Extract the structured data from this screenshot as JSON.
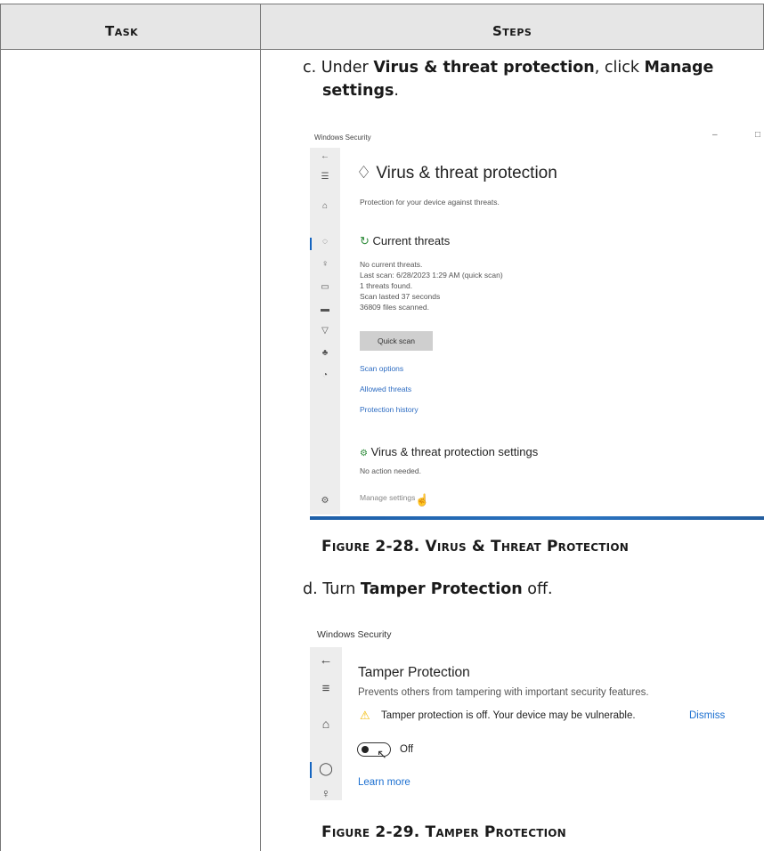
{
  "table": {
    "col_task": "Task",
    "col_steps": "Steps"
  },
  "step_c": {
    "marker": "c.",
    "pre": "Under ",
    "bold1": "Virus & threat protection",
    "mid": ", click ",
    "bold2": "Manage",
    "bold2b": "settings",
    "end": "."
  },
  "figure1": {
    "caption": "Figure 2-28. Virus & Threat Protection",
    "window_title": "Windows Security",
    "page_title": "Virus & threat protection",
    "page_subtitle": "Protection for your device against threats.",
    "section_current": "Current threats",
    "current_lines": [
      "No current threats.",
      "Last scan: 6/28/2023 1:29 AM (quick scan)",
      "1 threats found.",
      "Scan lasted 37 seconds",
      "36809 files scanned."
    ],
    "quick_scan": "Quick scan",
    "links": [
      "Scan options",
      "Allowed threats",
      "Protection history"
    ],
    "section_settings": "Virus & threat protection settings",
    "settings_status": "No action needed.",
    "manage_settings": "Manage settings"
  },
  "step_d": {
    "marker": "d.",
    "pre": "Turn ",
    "bold": "Tamper Protection",
    "end": " off."
  },
  "figure2": {
    "caption": "Figure 2-29. Tamper Protection",
    "window_title": "Windows Security",
    "page_title": "Tamper Protection",
    "description": "Prevents others from tampering with important security features.",
    "warning": "Tamper protection is off. Your device may be vulnerable.",
    "dismiss": "Dismiss",
    "toggle_state": "Off",
    "learn_more": "Learn more"
  },
  "colors": {
    "header_bg": "#e6e6e6",
    "link_blue": "#2d6cc2",
    "accent_blue": "#1565c0",
    "warning_yellow": "#f2b900"
  }
}
